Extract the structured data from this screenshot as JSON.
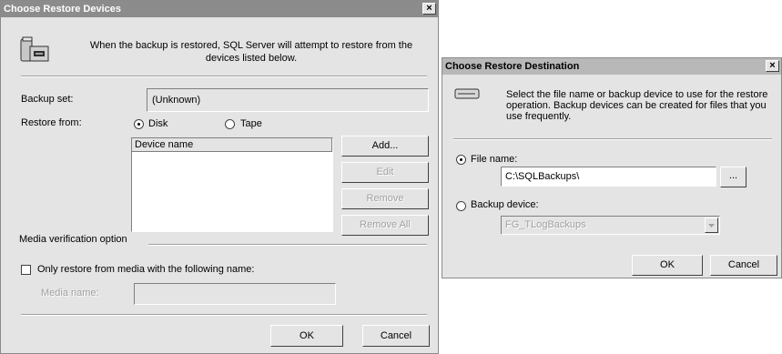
{
  "restore_devices": {
    "title": "Choose Restore Devices",
    "close": "×",
    "intro": "When the backup is restored, SQL Server will attempt to restore from the devices listed below.",
    "backup_set_label": "Backup set:",
    "backup_set_value": "(Unknown)",
    "restore_from_label": "Restore from:",
    "disk_label": "Disk",
    "tape_label": "Tape",
    "device_column": "Device name",
    "add_button": "Add...",
    "edit_button": "Edit",
    "remove_button": "Remove",
    "remove_all_button": "Remove All",
    "media_verification_label": "Media verification option",
    "only_restore_label": "Only restore from media with the following name:",
    "media_name_label": "Media name:",
    "media_name_value": "",
    "ok_button": "OK",
    "cancel_button": "Cancel"
  },
  "restore_destination": {
    "title": "Choose Restore Destination",
    "close": "×",
    "intro": "Select the file name or backup device to use for the restore operation.  Backup devices can be created for files that you use frequently.",
    "file_name_label": "File name:",
    "file_name_value": "C:\\SQLBackups\\",
    "browse_button": "...",
    "backup_device_label": "Backup device:",
    "backup_device_value": "FG_TLogBackups",
    "ok_button": "OK",
    "cancel_button": "Cancel"
  }
}
